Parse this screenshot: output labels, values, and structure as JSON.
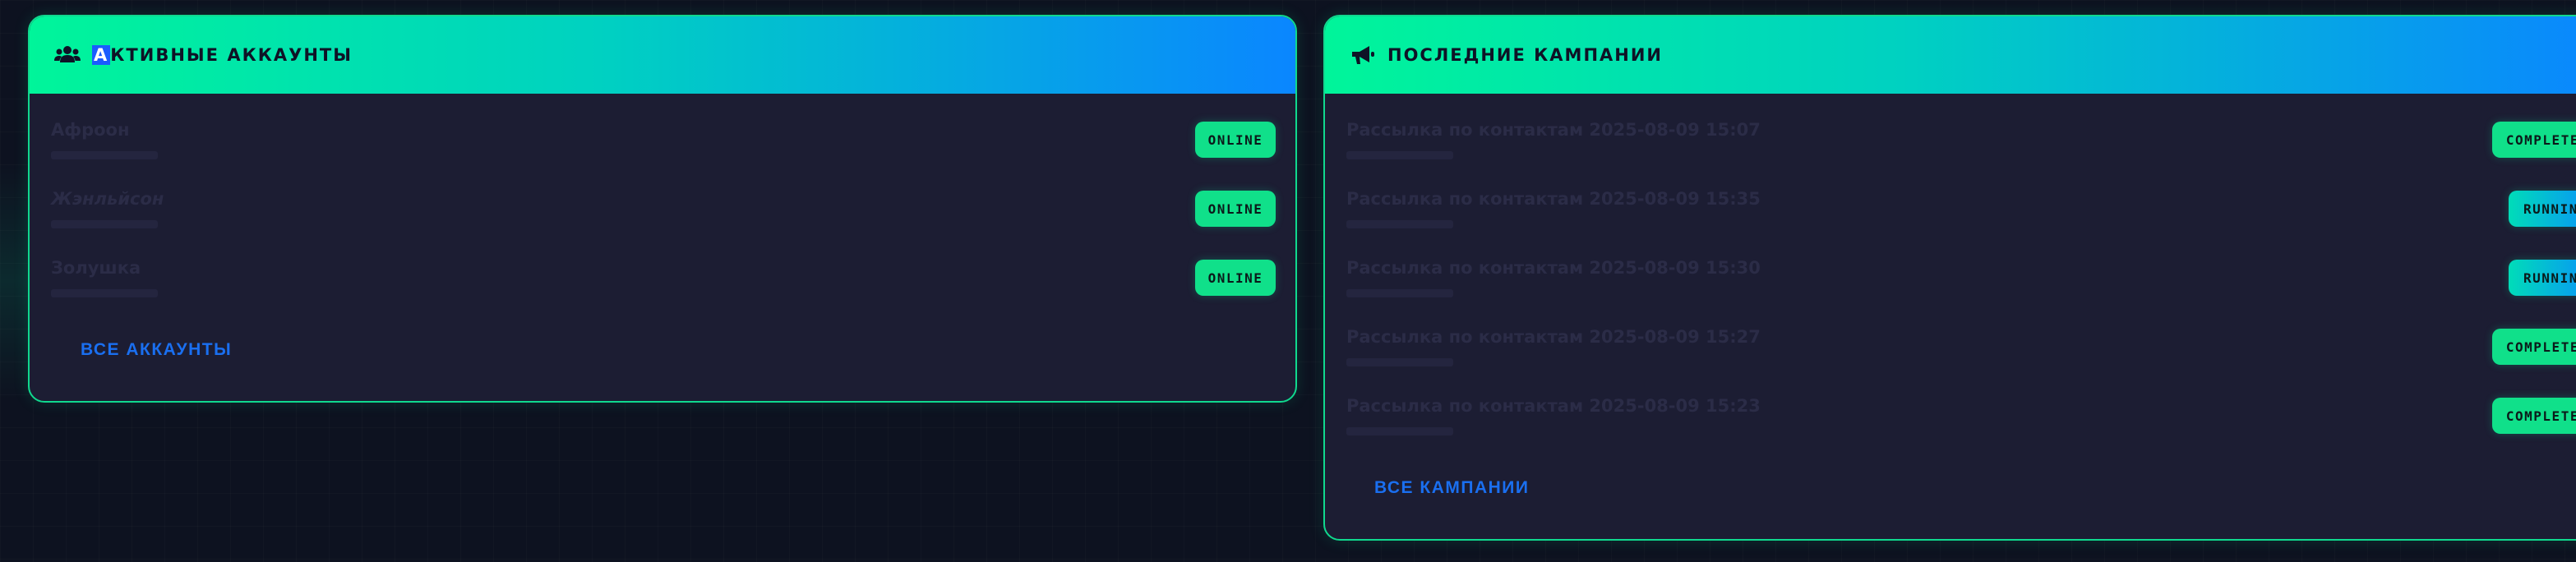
{
  "accounts_card": {
    "title_first": "А",
    "title_rest": "КТИВНЫЕ АККАУНТЫ",
    "icon": "users-icon",
    "rows": [
      {
        "name": "Афроон",
        "status": "ONLINE"
      },
      {
        "name": "Жэнльйсон",
        "status": "ONLINE"
      },
      {
        "name": "Золушка",
        "status": "ONLINE"
      }
    ],
    "link": "ВСЕ АККАУНТЫ"
  },
  "campaigns_card": {
    "title": "ПОСЛЕДНИЕ КАМПАНИИ",
    "icon": "megaphone-icon",
    "rows": [
      {
        "name": "Рассылка по контактам 2025-08-09 15:07",
        "status": "COMPLETED"
      },
      {
        "name": "Рассылка по контактам 2025-08-09 15:35",
        "status": "RUNNING"
      },
      {
        "name": "Рассылка по контактам 2025-08-09 15:30",
        "status": "RUNNING"
      },
      {
        "name": "Рассылка по контактам 2025-08-09 15:27",
        "status": "COMPLETED"
      },
      {
        "name": "Рассылка по контактам 2025-08-09 15:23",
        "status": "COMPLETED"
      }
    ],
    "link": "ВСЕ КАМПАНИИ"
  },
  "colors": {
    "accent_green": "#10e08a",
    "accent_blue": "#0a86ff",
    "link_blue": "#1a6ff0",
    "card_bg": "#1c1d33"
  }
}
